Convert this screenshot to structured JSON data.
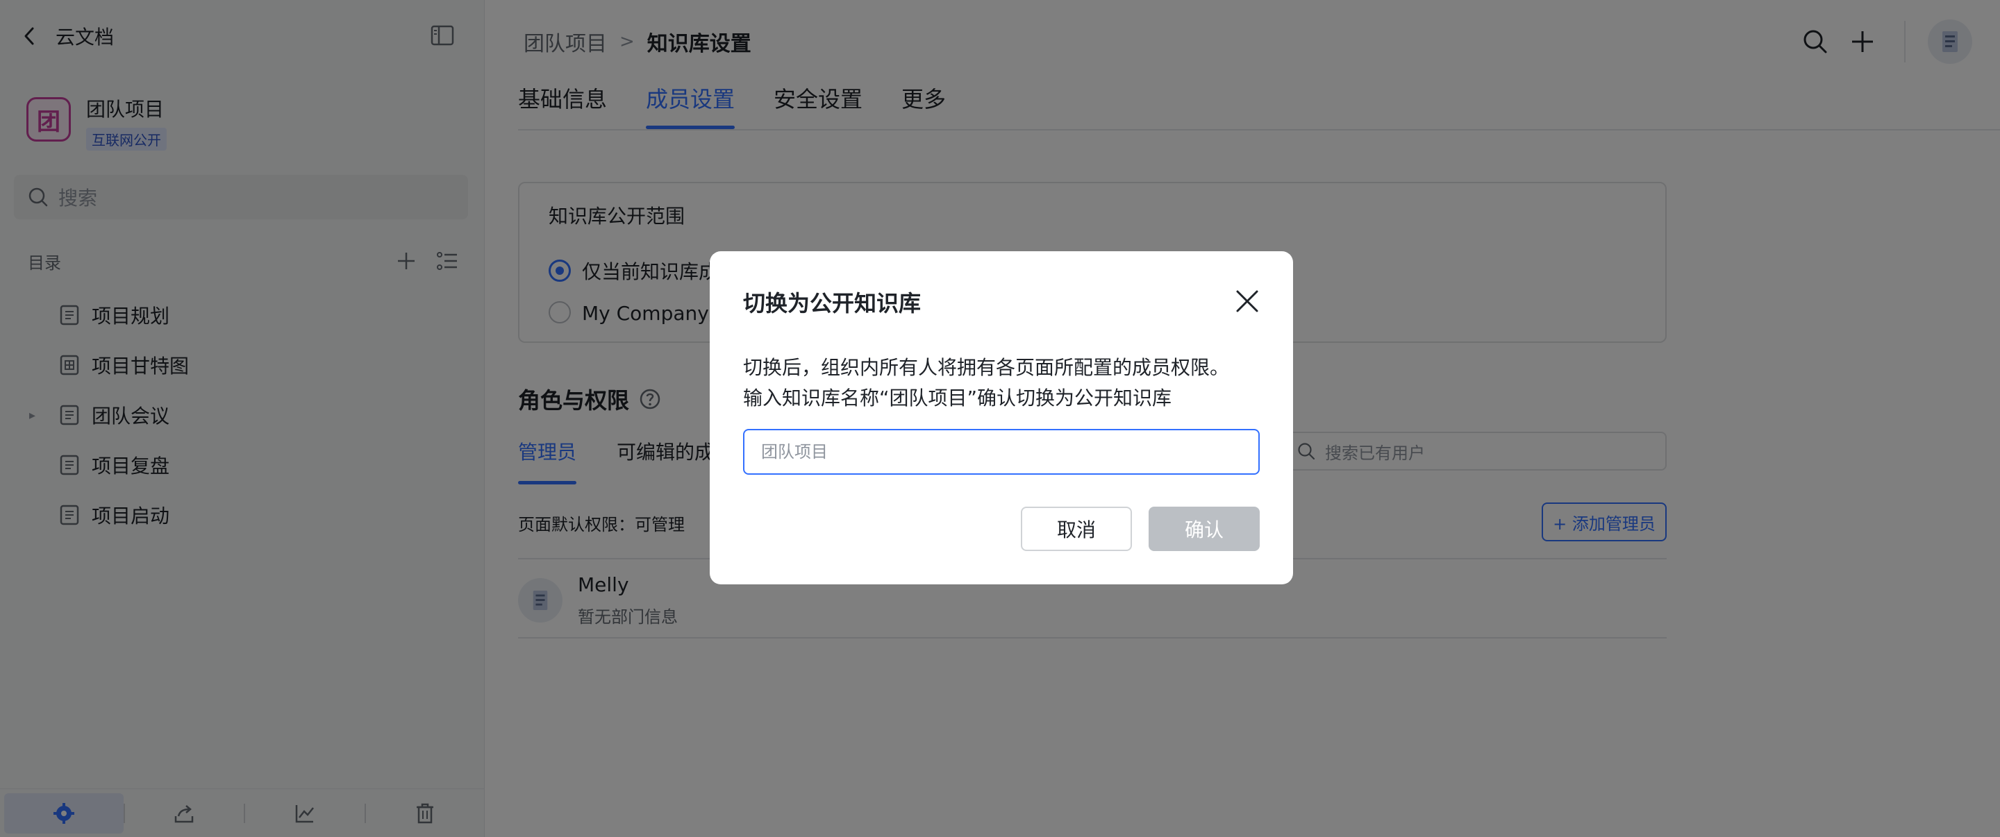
{
  "sidebar": {
    "back_label": "云文档",
    "workspace": {
      "logo_char": "团",
      "name": "团队项目",
      "badge": "互联网公开"
    },
    "search_placeholder": "搜索",
    "catalog_label": "目录",
    "items": [
      {
        "label": "项目规划",
        "icon": "doc-icon"
      },
      {
        "label": "项目甘特图",
        "icon": "table-icon"
      },
      {
        "label": "团队会议",
        "icon": "doc-icon",
        "expandable": true
      },
      {
        "label": "项目复盘",
        "icon": "doc-icon"
      },
      {
        "label": "项目启动",
        "icon": "doc-icon"
      }
    ],
    "bottom_buttons": [
      "settings-icon",
      "share-icon",
      "chart-icon",
      "trash-icon"
    ]
  },
  "header": {
    "breadcrumb": {
      "parent": "团队项目",
      "separator": ">",
      "current": "知识库设置"
    }
  },
  "tabs": [
    {
      "label": "基础信息",
      "active": false
    },
    {
      "label": "成员设置",
      "active": true
    },
    {
      "label": "安全设置",
      "active": false
    },
    {
      "label": "更多",
      "active": false
    }
  ],
  "visibility_card": {
    "title": "知识库公开范围",
    "options": [
      {
        "label": "仅当前知识库成",
        "checked": true
      },
      {
        "label": "My Company所",
        "checked": false
      }
    ]
  },
  "roles": {
    "title": "角色与权限",
    "subtabs": [
      {
        "label": "管理员",
        "active": true
      },
      {
        "label": "可编辑的成",
        "active": false
      }
    ],
    "search_placeholder": "搜索已有用户",
    "default_permission": "页面默认权限：可管理",
    "add_admin_label": "+ 添加管理员",
    "members": [
      {
        "name": "Melly",
        "dept": "暂无部门信息"
      }
    ]
  },
  "modal": {
    "title": "切换为公开知识库",
    "line1": "切换后，组织内所有人将拥有各页面所配置的成员权限。",
    "line2": "输入知识库名称“团队项目”确认切换为公开知识库",
    "input_placeholder": "团队项目",
    "input_value": "",
    "cancel_label": "取消",
    "confirm_label": "确认"
  },
  "colors": {
    "accent": "#3370ff",
    "workspace_brand": "#c43e9c",
    "overlay": "rgba(0,0,0,0.5)",
    "disabled_button": "#bbbfc4"
  }
}
